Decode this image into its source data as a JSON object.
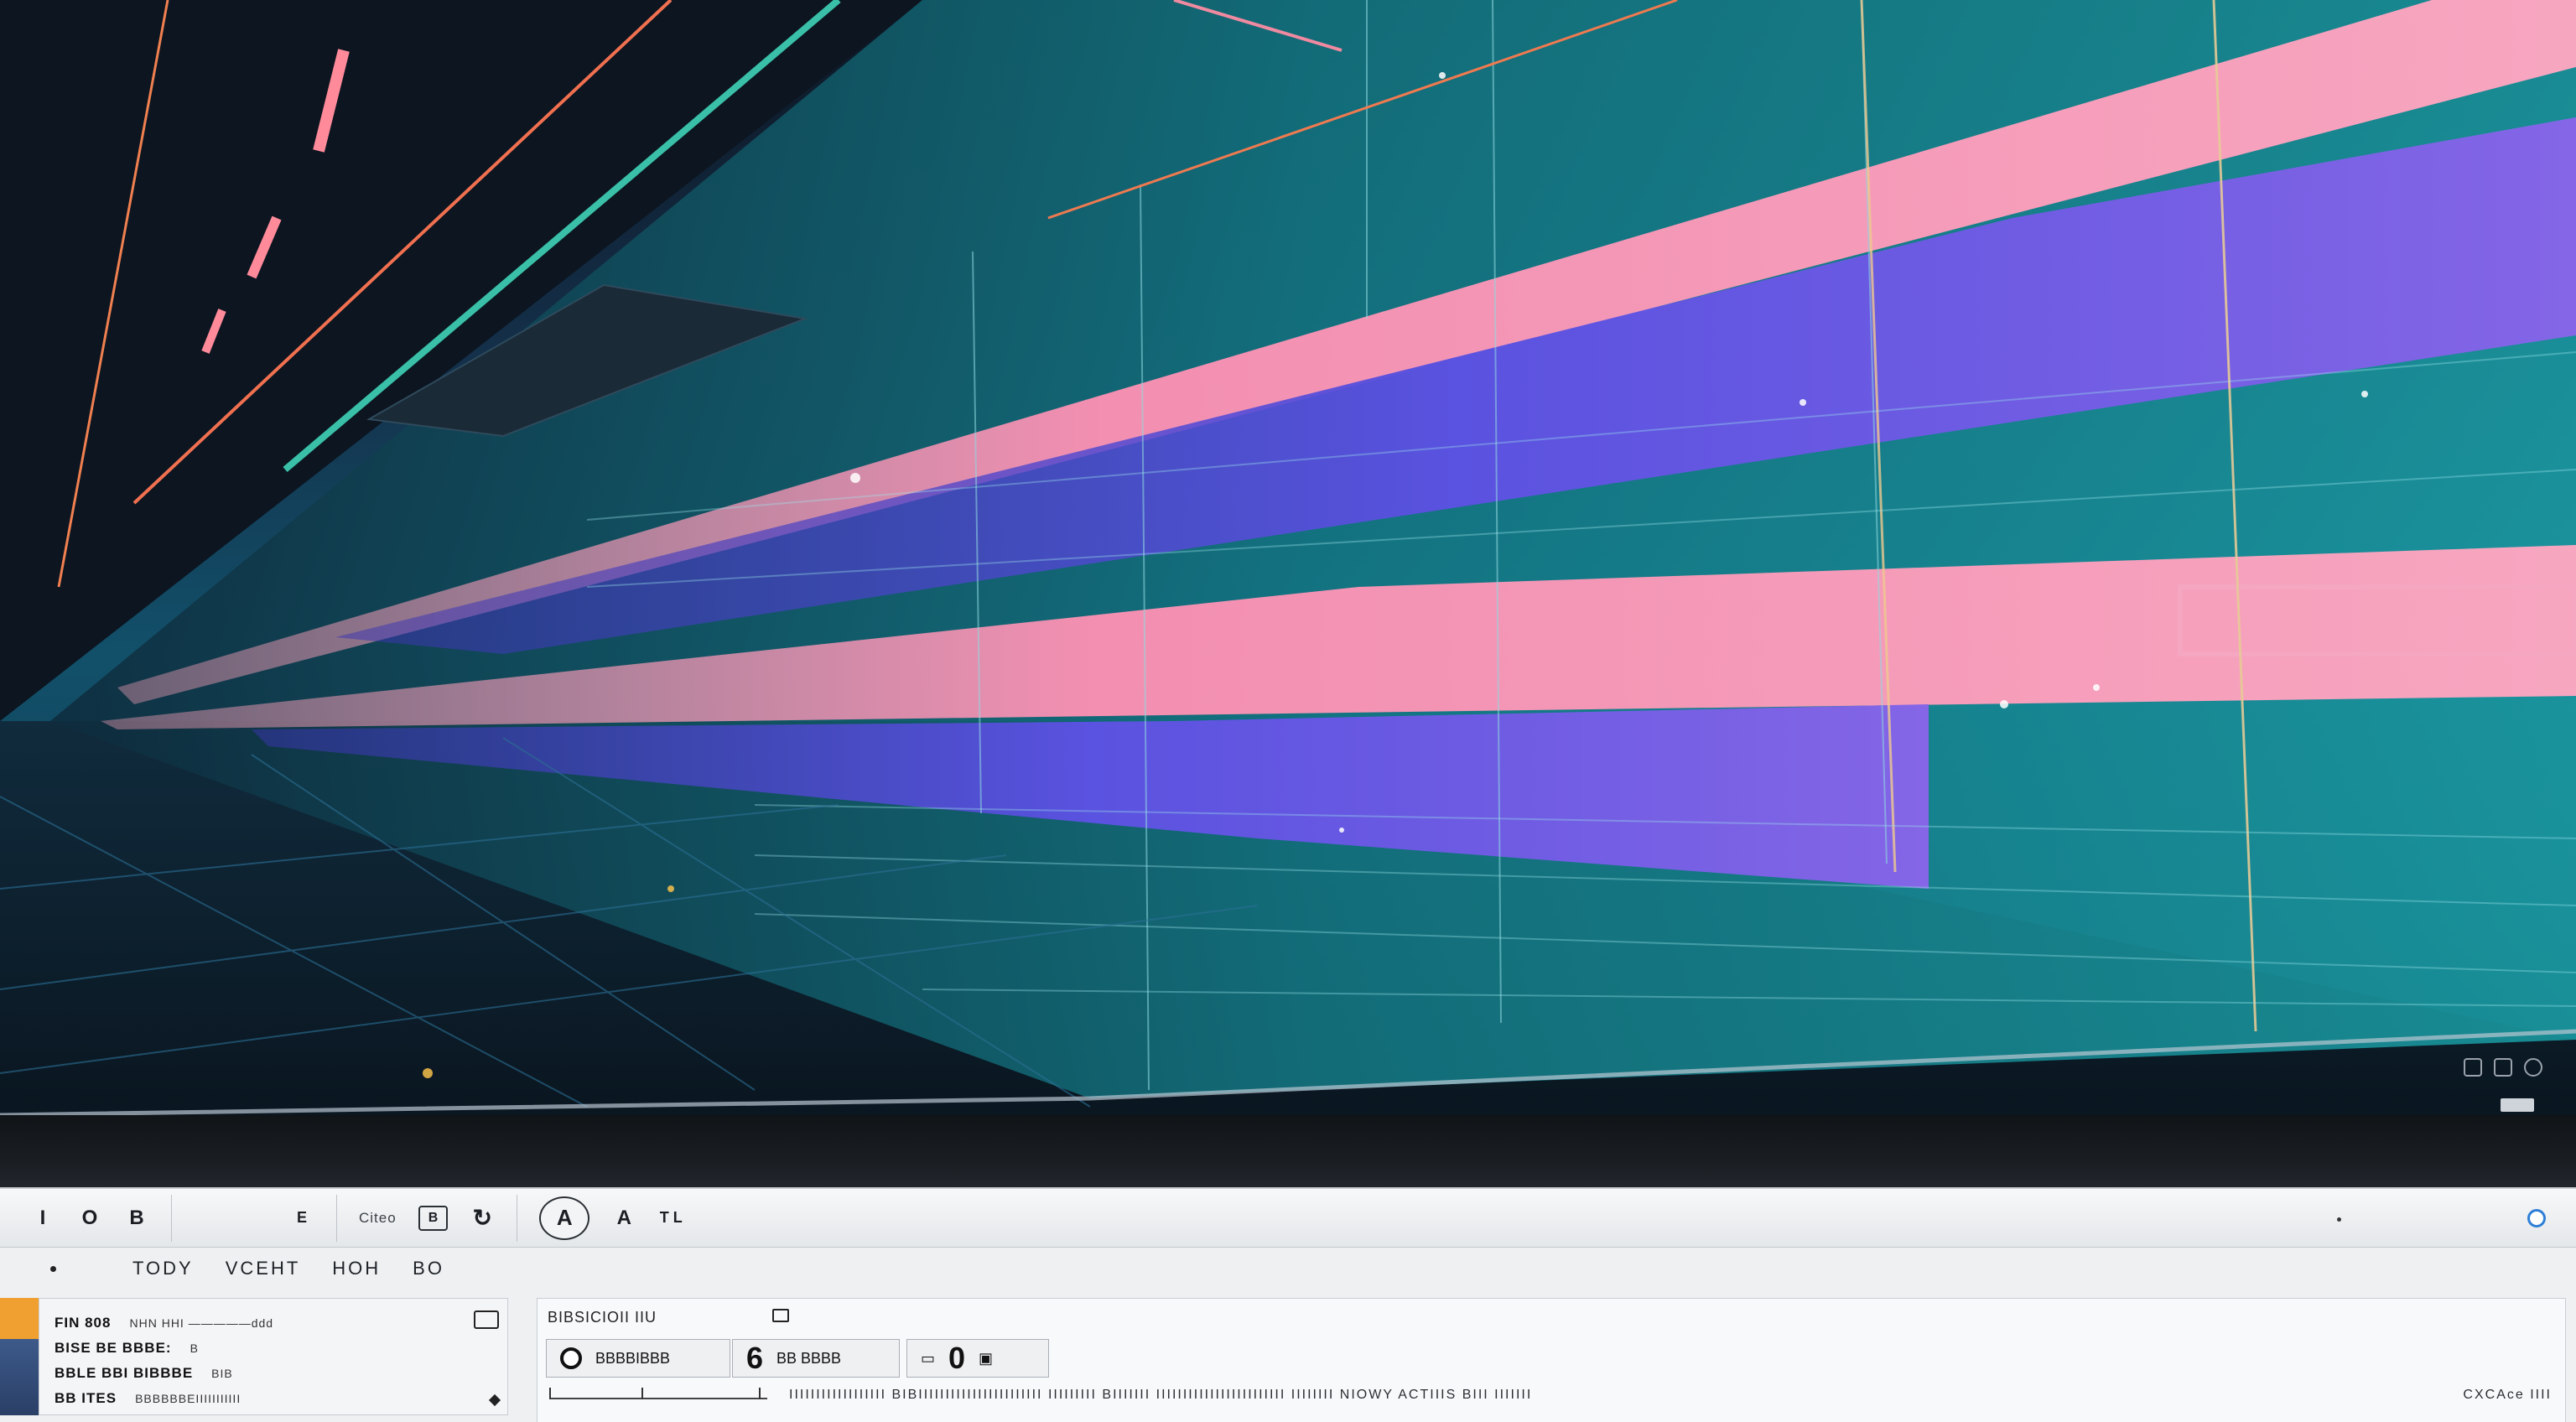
{
  "toolbar": {
    "group1": [
      "I",
      "O",
      "B"
    ],
    "group2_label": "E",
    "style_label": "Citeo",
    "group3_box": "B",
    "circle_btn": "A",
    "pen_btn": "A",
    "tail_btn": "T L"
  },
  "menubar": {
    "items": [
      "TODY",
      "VCEHT",
      "HOH",
      "BO"
    ]
  },
  "left_panel": {
    "rows": [
      {
        "label": "FIN 808",
        "detail": "NHN HHI —————ddd"
      },
      {
        "label": "BISE BE BBBE:",
        "detail": "B"
      },
      {
        "label": "BBLE BBI BIBBBE",
        "detail": "BIB"
      },
      {
        "label": "BB ITES",
        "detail": "BBBBBBEIIIIIIIIIII"
      }
    ]
  },
  "main_panel": {
    "title": "BIBSICIOII IIU",
    "control1_label": "BBBBIBBB",
    "control2_big": "6",
    "control2_label": "BB BBBB",
    "control3_big": "0",
    "status_text": "IIIIIIIIIIIIIIIIII BIBIIIIIIIIIIIIIIIIIIIIIII IIIIIIIII BIIIIIII IIIIIIIIIIIIIIIIIIIIIIII IIIIIIII NIOWY ACTIIIS   BIII IIIIIII",
    "status_right": "CXCAce   IIII"
  },
  "colors": {
    "neon_pink": "#f28fb0",
    "neon_violet": "#6f5ae6",
    "teal": "#1aa7a8",
    "accent_blue": "#2e7fd6",
    "sidebar_orange": "#f0a030"
  }
}
